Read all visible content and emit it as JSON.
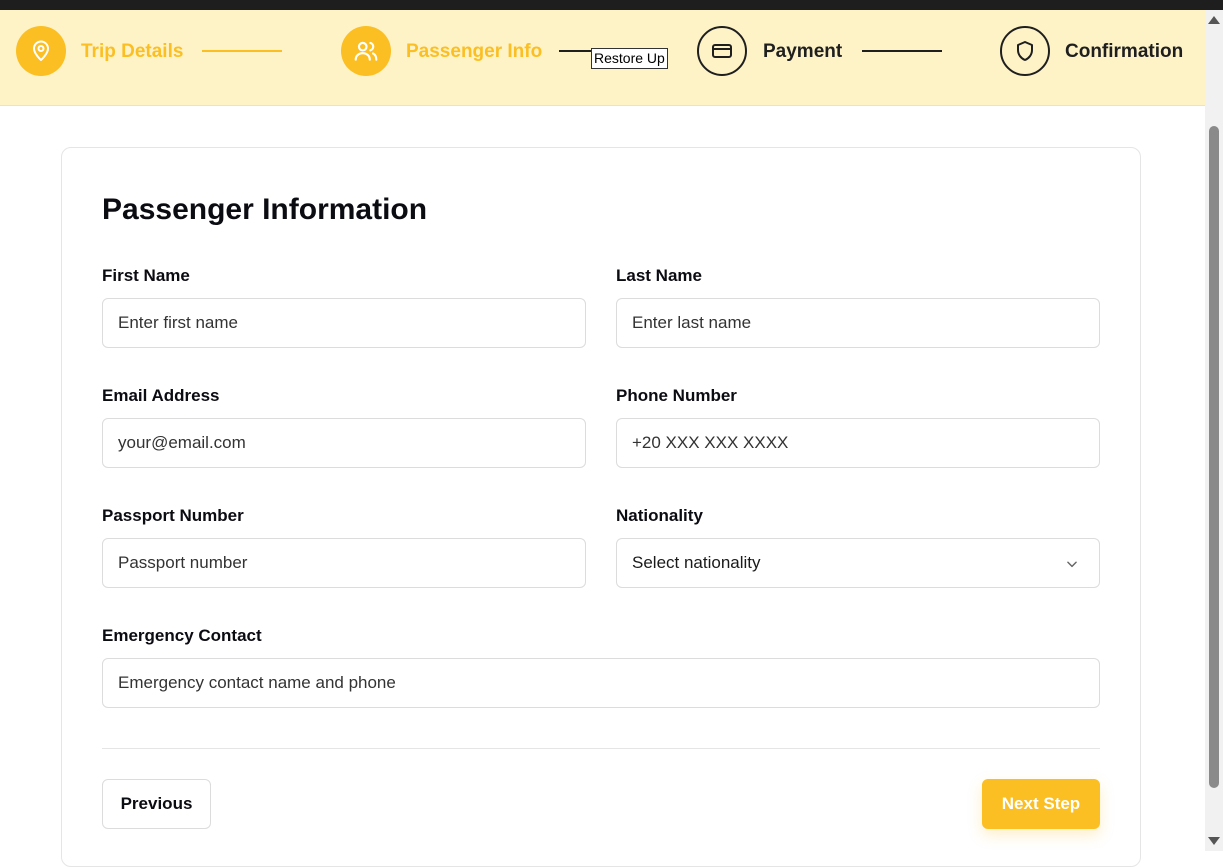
{
  "stepper": {
    "steps": [
      {
        "label": "Trip Details",
        "icon": "map-pin-icon",
        "state": "completed"
      },
      {
        "label": "Passenger Info",
        "icon": "users-icon",
        "state": "active"
      },
      {
        "label": "Payment",
        "icon": "credit-card-icon",
        "state": "pending"
      },
      {
        "label": "Confirmation",
        "icon": "shield-icon",
        "state": "pending"
      }
    ],
    "tooltip": "Restore Up"
  },
  "form": {
    "title": "Passenger Information",
    "first_name": {
      "label": "First Name",
      "placeholder": "Enter first name",
      "value": ""
    },
    "last_name": {
      "label": "Last Name",
      "placeholder": "Enter last name",
      "value": ""
    },
    "email": {
      "label": "Email Address",
      "placeholder": "your@email.com",
      "value": ""
    },
    "phone": {
      "label": "Phone Number",
      "placeholder": "+20 XXX XXX XXXX",
      "value": ""
    },
    "passport": {
      "label": "Passport Number",
      "placeholder": "Passport number",
      "value": ""
    },
    "nationality": {
      "label": "Nationality",
      "selected": "Select nationality",
      "icon": "chevron-down-icon"
    },
    "emergency": {
      "label": "Emergency Contact",
      "placeholder": "Emergency contact name and phone",
      "value": ""
    }
  },
  "buttons": {
    "previous": "Previous",
    "next": "Next Step"
  },
  "colors": {
    "accent": "#fbbf24",
    "stepper_bg": "#fef3c7",
    "dark": "#1f1f1f"
  }
}
